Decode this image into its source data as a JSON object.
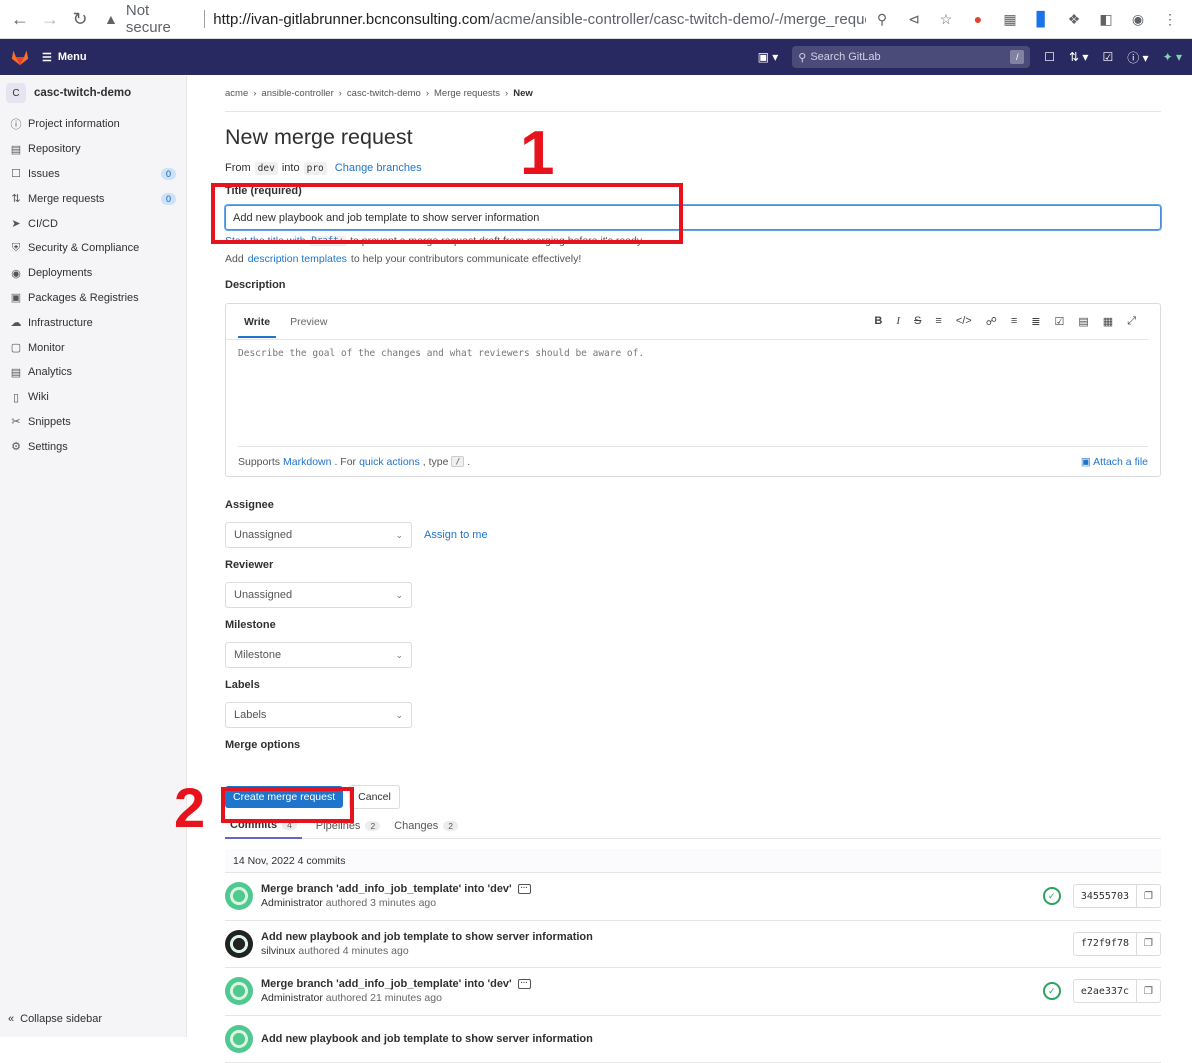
{
  "browser": {
    "security": "Not secure",
    "url_host": "http://ivan-gitlabrunner.bcnconsulting.com",
    "url_path": "/acme/ansible-controller/casc-twitch-demo/-/merge_reque..."
  },
  "topbar": {
    "menu_label": "Menu",
    "search_placeholder": "Search GitLab",
    "search_shortcut": "/"
  },
  "sidebar": {
    "project_initial": "C",
    "project_name": "casc-twitch-demo",
    "items": [
      {
        "label": "Project information",
        "icon": "info-icon"
      },
      {
        "label": "Repository",
        "icon": "doc-icon"
      },
      {
        "label": "Issues",
        "icon": "issues-icon",
        "badge": "0"
      },
      {
        "label": "Merge requests",
        "icon": "merge-icon",
        "badge": "0"
      },
      {
        "label": "CI/CD",
        "icon": "rocket-icon"
      },
      {
        "label": "Security & Compliance",
        "icon": "shield-icon"
      },
      {
        "label": "Deployments",
        "icon": "deploy-icon"
      },
      {
        "label": "Packages & Registries",
        "icon": "package-icon"
      },
      {
        "label": "Infrastructure",
        "icon": "cloud-icon"
      },
      {
        "label": "Monitor",
        "icon": "monitor-icon"
      },
      {
        "label": "Analytics",
        "icon": "chart-icon"
      },
      {
        "label": "Wiki",
        "icon": "book-icon"
      },
      {
        "label": "Snippets",
        "icon": "scissors-icon"
      },
      {
        "label": "Settings",
        "icon": "gear-icon"
      }
    ],
    "collapse_label": "Collapse sidebar"
  },
  "breadcrumb": [
    "acme",
    "ansible-controller",
    "casc-twitch-demo",
    "Merge requests",
    "New"
  ],
  "page": {
    "title": "New merge request",
    "from_label": "From",
    "source_branch": "dev",
    "into_label": "into",
    "target_branch": "pro",
    "change_branches": "Change branches"
  },
  "form": {
    "title_label": "Title (required)",
    "title_value": "Add new playbook and job template to show server information",
    "draft_hint_link": "Start the title with",
    "draft_code": "Draft:",
    "draft_hint_rest": "to prevent a merge request draft from merging before it's ready.",
    "templates_prefix": "Add",
    "templates_link": "description templates",
    "templates_rest": "to help your contributors communicate effectively!",
    "description_label": "Description",
    "write_tab": "Write",
    "preview_tab": "Preview",
    "description_placeholder": "Describe the goal of the changes and what reviewers should be aware of.",
    "supports": "Supports",
    "markdown": "Markdown",
    "for_text": ". For",
    "quick_actions": "quick actions",
    "type_text": ", type",
    "slash": "/",
    "period": ".",
    "attach": "Attach a file",
    "assignee_label": "Assignee",
    "assignee_value": "Unassigned",
    "assign_to_me": "Assign to me",
    "reviewer_label": "Reviewer",
    "reviewer_value": "Unassigned",
    "milestone_label": "Milestone",
    "milestone_value": "Milestone",
    "labels_label": "Labels",
    "labels_value": "Labels",
    "merge_options_label": "Merge options",
    "create_button": "Create merge request",
    "cancel_button": "Cancel"
  },
  "tabs": [
    {
      "label": "Commits",
      "count": "4"
    },
    {
      "label": "Pipelines",
      "count": "2"
    },
    {
      "label": "Changes",
      "count": "2"
    }
  ],
  "commits_date": "14 Nov, 2022 4 commits",
  "commits": [
    {
      "message": "Merge branch 'add_info_job_template' into 'dev'",
      "author": "Administrator",
      "when": "authored 3 minutes ago",
      "sha": "34555703",
      "has_status": true,
      "has_ellipsis": true
    },
    {
      "message": "Add new playbook and job template to show server information",
      "author": "silvinux",
      "when": "authored 4 minutes ago",
      "sha": "f72f9f78",
      "has_status": false,
      "has_ellipsis": false
    },
    {
      "message": "Merge branch 'add_info_job_template' into 'dev'",
      "author": "Administrator",
      "when": "authored 21 minutes ago",
      "sha": "e2ae337c",
      "has_status": true,
      "has_ellipsis": true
    },
    {
      "message": "Add new playbook and job template to show server information",
      "author": "",
      "when": "",
      "sha": "",
      "has_status": false,
      "has_ellipsis": false
    }
  ],
  "annotations": {
    "one": "1",
    "two": "2"
  },
  "colors": {
    "accent": "#1f75cb",
    "topbar": "#292961",
    "annotation": "#e8121c"
  }
}
